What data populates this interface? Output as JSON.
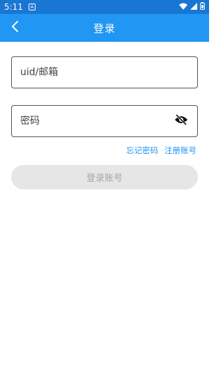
{
  "status_bar": {
    "time": "5:11",
    "notification_letter": "A"
  },
  "header": {
    "title": "登录"
  },
  "form": {
    "uid_placeholder": "uid/邮箱",
    "password_placeholder": "密码",
    "forgot_password": "忘记密码",
    "register": "注册账号",
    "login_button": "登录账号"
  },
  "colors": {
    "status_bar": "#1976d2",
    "app_bar": "#2196f3",
    "link": "#2196f3",
    "button_disabled_bg": "#e6e6e6",
    "button_disabled_text": "#a6a6a6"
  }
}
